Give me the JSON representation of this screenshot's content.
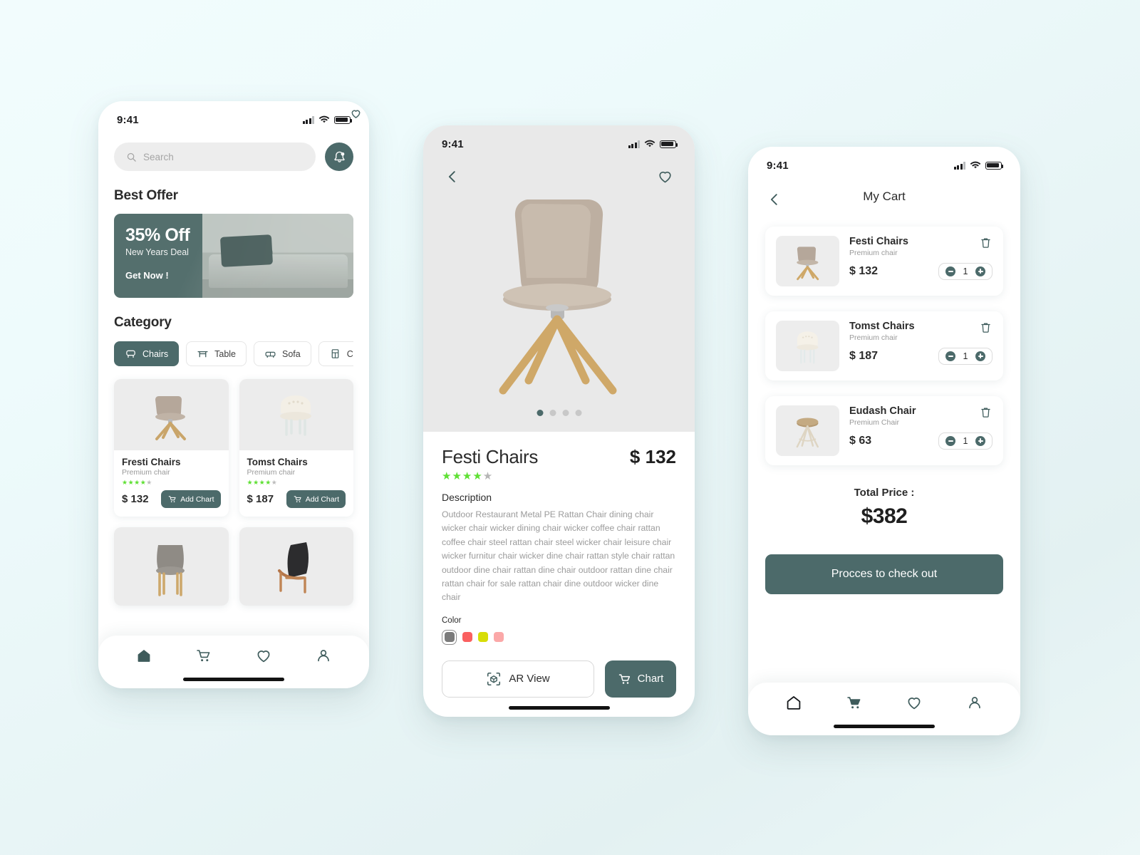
{
  "background": {
    "accent": "#4c6a6a",
    "star_color": "#5fe034",
    "page_bg": "#ecf7f7"
  },
  "status_bar": {
    "time": "9:41"
  },
  "home": {
    "search": {
      "placeholder": "Search",
      "icon": "search-icon"
    },
    "bell_icon": "notification-bell-icon",
    "best_offer_title": "Best Offer",
    "offer": {
      "percent": "35% Off",
      "subtitle": "New Years Deal",
      "cta": "Get Now !"
    },
    "category_title": "Category",
    "categories": [
      {
        "label": "Chairs",
        "icon": "chair-icon",
        "active": true
      },
      {
        "label": "Table",
        "icon": "table-icon",
        "active": false
      },
      {
        "label": "Sofa",
        "icon": "sofa-icon",
        "active": false
      },
      {
        "label": "Cu",
        "icon": "cupboard-icon",
        "active": false
      }
    ],
    "products": [
      {
        "name": "Fresti Chairs",
        "subtitle": "Premium chair",
        "price": "$ 132",
        "rating": 4,
        "button": "Add Chart"
      },
      {
        "name": "Tomst Chairs",
        "subtitle": "Premium chair",
        "price": "$ 187",
        "rating": 4,
        "button": "Add Chart"
      }
    ],
    "nav": [
      {
        "name": "home",
        "icon": "home-icon",
        "active": true
      },
      {
        "name": "cart",
        "icon": "cart-icon",
        "active": false
      },
      {
        "name": "favorites",
        "icon": "heart-icon",
        "active": false
      },
      {
        "name": "profile",
        "icon": "person-icon",
        "active": false
      }
    ]
  },
  "detail": {
    "back_icon": "chevron-left-icon",
    "favorite_icon": "heart-icon",
    "carousel": {
      "total_dots": 4,
      "active_index": 0
    },
    "title": "Festi Chairs",
    "price": "$ 132",
    "rating": 4,
    "description_label": "Description",
    "description": "Outdoor Restaurant Metal PE Rattan Chair dining chair wicker chair wicker dining chair wicker coffee chair rattan coffee chair steel rattan chair steel wicker chair leisure chair wicker furnitur chair wicker dine chair rattan style chair rattan outdoor dine chair rattan dine chair outdoor rattan dine chair rattan chair for sale rattan chair dine outdoor wicker dine chair",
    "color_label": "Color",
    "colors": [
      {
        "hex": "#7b7b7b",
        "selected": true
      },
      {
        "hex": "#fa6060",
        "selected": false
      },
      {
        "hex": "#d7dd07",
        "selected": false
      },
      {
        "hex": "#fba8a8",
        "selected": false
      }
    ],
    "ar_button": "AR View",
    "ar_icon": "ar-cube-icon",
    "cart_button": "Chart",
    "cart_icon": "cart-icon"
  },
  "cart": {
    "back_icon": "chevron-left-icon",
    "title": "My Cart",
    "items": [
      {
        "name": "Festi Chairs",
        "subtitle": "Premium chair",
        "price": "$ 132",
        "qty": "1",
        "delete_icon": "trash-icon"
      },
      {
        "name": "Tomst Chairs",
        "subtitle": "Premium chair",
        "price": "$ 187",
        "qty": "1",
        "delete_icon": "trash-icon"
      },
      {
        "name": "Eudash Chair",
        "subtitle": "Premium Chair",
        "price": "$ 63",
        "qty": "1",
        "delete_icon": "trash-icon"
      }
    ],
    "total_label": "Total Price :",
    "total_value": "$382",
    "checkout_button": "Procces to check out",
    "nav": [
      {
        "name": "home",
        "icon": "home-icon",
        "active": false
      },
      {
        "name": "cart",
        "icon": "cart-icon",
        "active": true
      },
      {
        "name": "favorites",
        "icon": "heart-icon",
        "active": false
      },
      {
        "name": "profile",
        "icon": "person-icon",
        "active": false
      }
    ]
  }
}
